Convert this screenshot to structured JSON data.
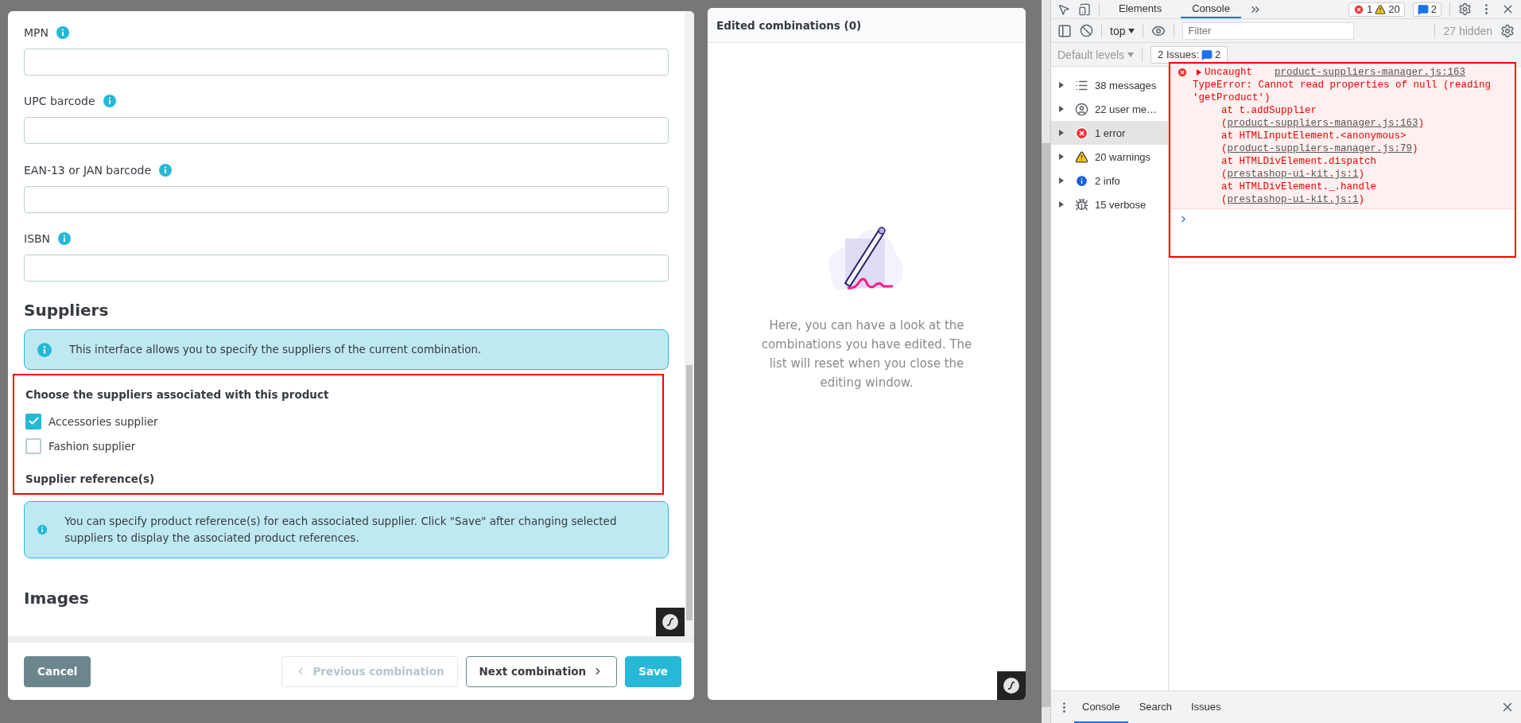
{
  "modal": {
    "fields": [
      {
        "label": "MPN"
      },
      {
        "label": "UPC barcode"
      },
      {
        "label": "EAN-13 or JAN barcode"
      },
      {
        "label": "ISBN"
      }
    ],
    "suppliers": {
      "title": "Suppliers",
      "info": "This interface allows you to specify the suppliers of the current combination.",
      "highlighted": true,
      "choose_label": "Choose the suppliers associated with this product",
      "options": [
        {
          "label": "Accessories supplier",
          "checked": true
        },
        {
          "label": "Fashion supplier",
          "checked": false
        }
      ],
      "reference_label": "Supplier reference(s)",
      "reference_info": "You can specify product reference(s) for each associated supplier. Click \"Save\" after changing selected suppliers to display the associated product references."
    },
    "images_title": "Images",
    "footer": {
      "cancel": "Cancel",
      "previous": {
        "label": "Previous combination",
        "disabled": true
      },
      "next": {
        "label": "Next combination",
        "disabled": false
      },
      "save": "Save"
    }
  },
  "edited_panel": {
    "title": "Edited combinations (0)",
    "empty_text": "Here, you can have a look at the combinations you have edited. The list will reset when you close the editing window."
  },
  "devtools": {
    "tabs": [
      {
        "label": "Elements",
        "selected": false
      },
      {
        "label": "Console",
        "selected": true
      }
    ],
    "badges": {
      "errors": "1",
      "warnings": "20",
      "issues": "2"
    },
    "context": "top",
    "filter_placeholder": "Filter",
    "hidden": "27 hidden",
    "levels": "Default levels",
    "issues_label": "2 Issues:",
    "issues_count": "2",
    "sidebar": [
      {
        "kind": "messages",
        "label": "38 messages",
        "selected": false
      },
      {
        "kind": "user",
        "label": "22 user me…",
        "selected": false
      },
      {
        "kind": "error",
        "label": "1 error",
        "selected": true
      },
      {
        "kind": "warning",
        "label": "20 warnings",
        "selected": false
      },
      {
        "kind": "info",
        "label": "2 info",
        "selected": false
      },
      {
        "kind": "verbose",
        "label": "15 verbose",
        "selected": false
      }
    ],
    "error": {
      "highlighted": true,
      "title": "Uncaught",
      "source": "product-suppliers-manager.js:163",
      "message": "TypeError: Cannot read properties of null (reading 'getProduct')",
      "stack": [
        {
          "at": "at t.addSupplier (",
          "link": "product-suppliers-manager.js:163",
          "end": ")"
        },
        {
          "at": "at HTMLInputElement.<anonymous> (",
          "link": "product-suppliers-manager.js:79",
          "end": ")"
        },
        {
          "at": "at HTMLDivElement.dispatch (",
          "link": "prestashop-ui-kit.js:1",
          "end": ")"
        },
        {
          "at": "at HTMLDivElement._.handle (",
          "link": "prestashop-ui-kit.js:1",
          "end": ")"
        }
      ]
    },
    "drawer_tabs": [
      {
        "label": "Console",
        "selected": true
      },
      {
        "label": "Search",
        "selected": false
      },
      {
        "label": "Issues",
        "selected": false
      }
    ]
  }
}
